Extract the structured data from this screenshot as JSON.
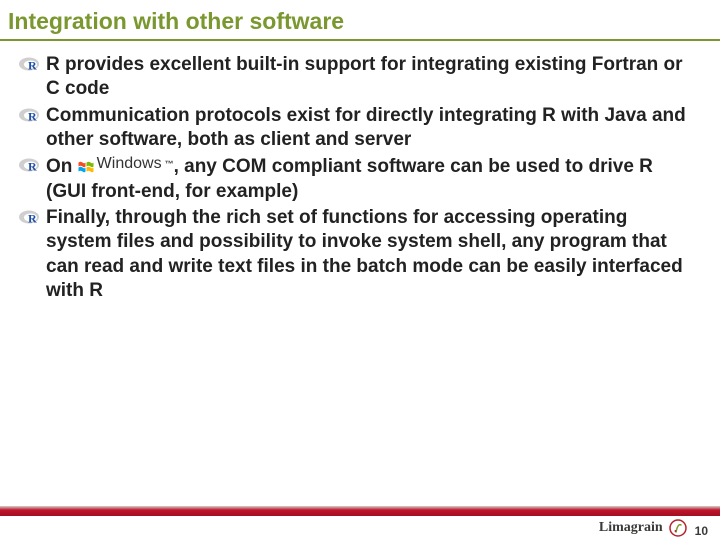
{
  "title": "Integration with other software",
  "bullets": [
    {
      "text": "R provides excellent built-in support for integrating existing Fortran or C code"
    },
    {
      "text": "Communication protocols exist for directly integrating R with Java and other software, both as client and server"
    },
    {
      "prefix": "On ",
      "windows_label": "Windows",
      "suffix": ", any COM compliant software can be used to drive R (GUI front-end, for example)"
    },
    {
      "text": "Finally, through the rich set of functions for accessing operating system files and possibility to invoke system shell, any program that can read and write text files in the batch mode can be easily interfaced with R"
    }
  ],
  "footer": {
    "brand": "Limagrain",
    "page": "10"
  }
}
